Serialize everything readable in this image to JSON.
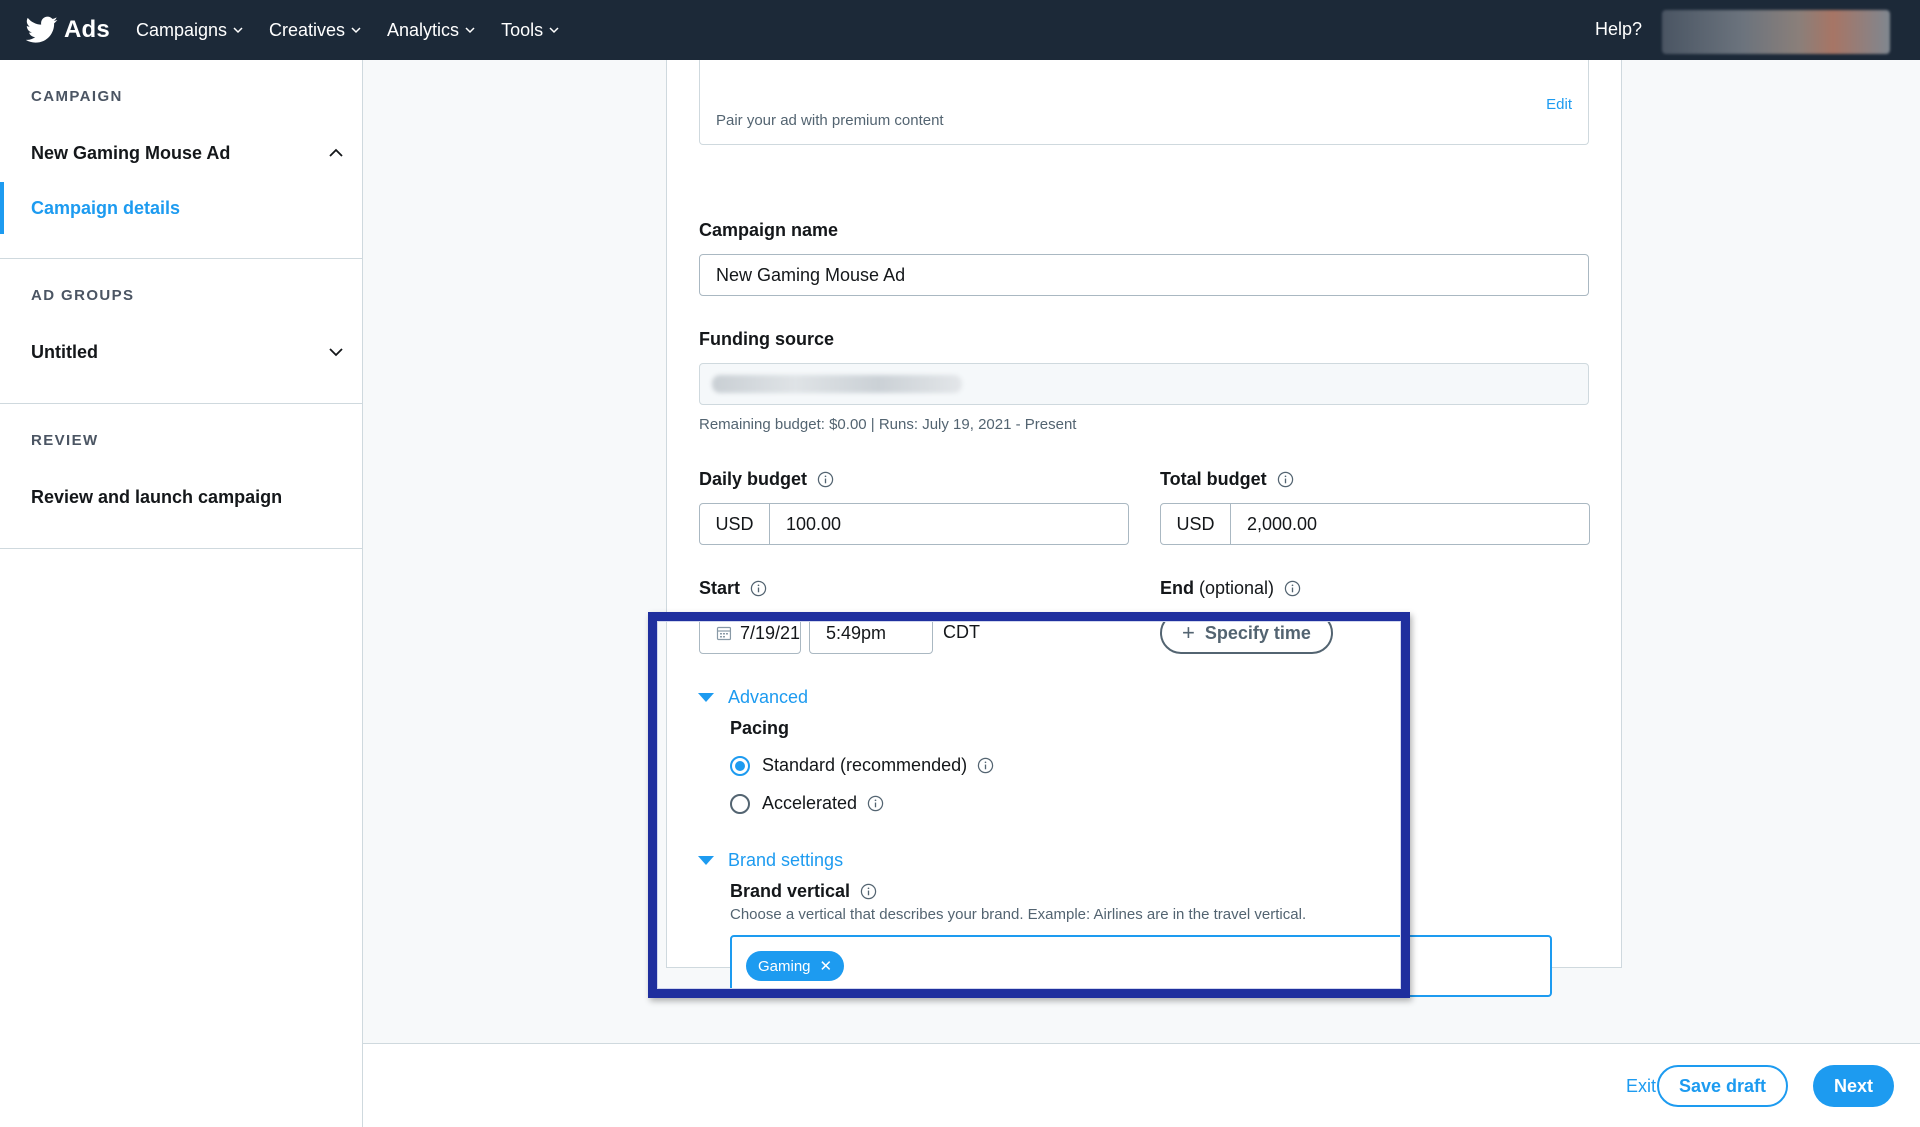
{
  "topbar": {
    "logo_text": "Ads",
    "nav": [
      {
        "label": "Campaigns"
      },
      {
        "label": "Creatives"
      },
      {
        "label": "Analytics"
      },
      {
        "label": "Tools"
      }
    ],
    "help": "Help?"
  },
  "sidebar": {
    "campaign_heading": "CAMPAIGN",
    "campaign_name": "New Gaming Mouse Ad",
    "campaign_details": "Campaign details",
    "ad_groups_heading": "AD GROUPS",
    "ad_group_name": "Untitled",
    "review_heading": "REVIEW",
    "review_item": "Review and launch campaign"
  },
  "form": {
    "pair_text": "Pair your ad with premium content",
    "pair_edit": "Edit",
    "campaign_name_label": "Campaign name",
    "campaign_name_value": "New Gaming Mouse Ad",
    "funding_label": "Funding source",
    "funding_helper": "Remaining budget: $0.00 | Runs: July 19, 2021 - Present",
    "daily_label": "Daily budget",
    "daily_currency": "USD",
    "daily_value": "100.00",
    "total_label": "Total budget",
    "total_currency": "USD",
    "total_value": "2,000.00",
    "start_label": "Start",
    "start_date": "7/19/21",
    "start_time": "5:49pm",
    "timezone": "CDT",
    "end_label": "End",
    "end_optional": "(optional)",
    "specify_time": "Specify time",
    "advanced_label": "Advanced",
    "pacing_label": "Pacing",
    "pacing_options": [
      {
        "label": "Standard (recommended)",
        "selected": true
      },
      {
        "label": "Accelerated",
        "selected": false
      }
    ],
    "brand_settings_label": "Brand settings",
    "brand_vertical_label": "Brand vertical",
    "brand_vertical_helper": "Choose a vertical that describes your brand. Example: Airlines are in the travel vertical.",
    "brand_vertical_tags": [
      "Gaming"
    ]
  },
  "footer": {
    "exit": "Exit",
    "save_draft": "Save draft",
    "next": "Next"
  },
  "colors": {
    "nav_bg": "#1c2938",
    "accent": "#1d9bf0",
    "highlight_border": "#1f2f9e"
  }
}
